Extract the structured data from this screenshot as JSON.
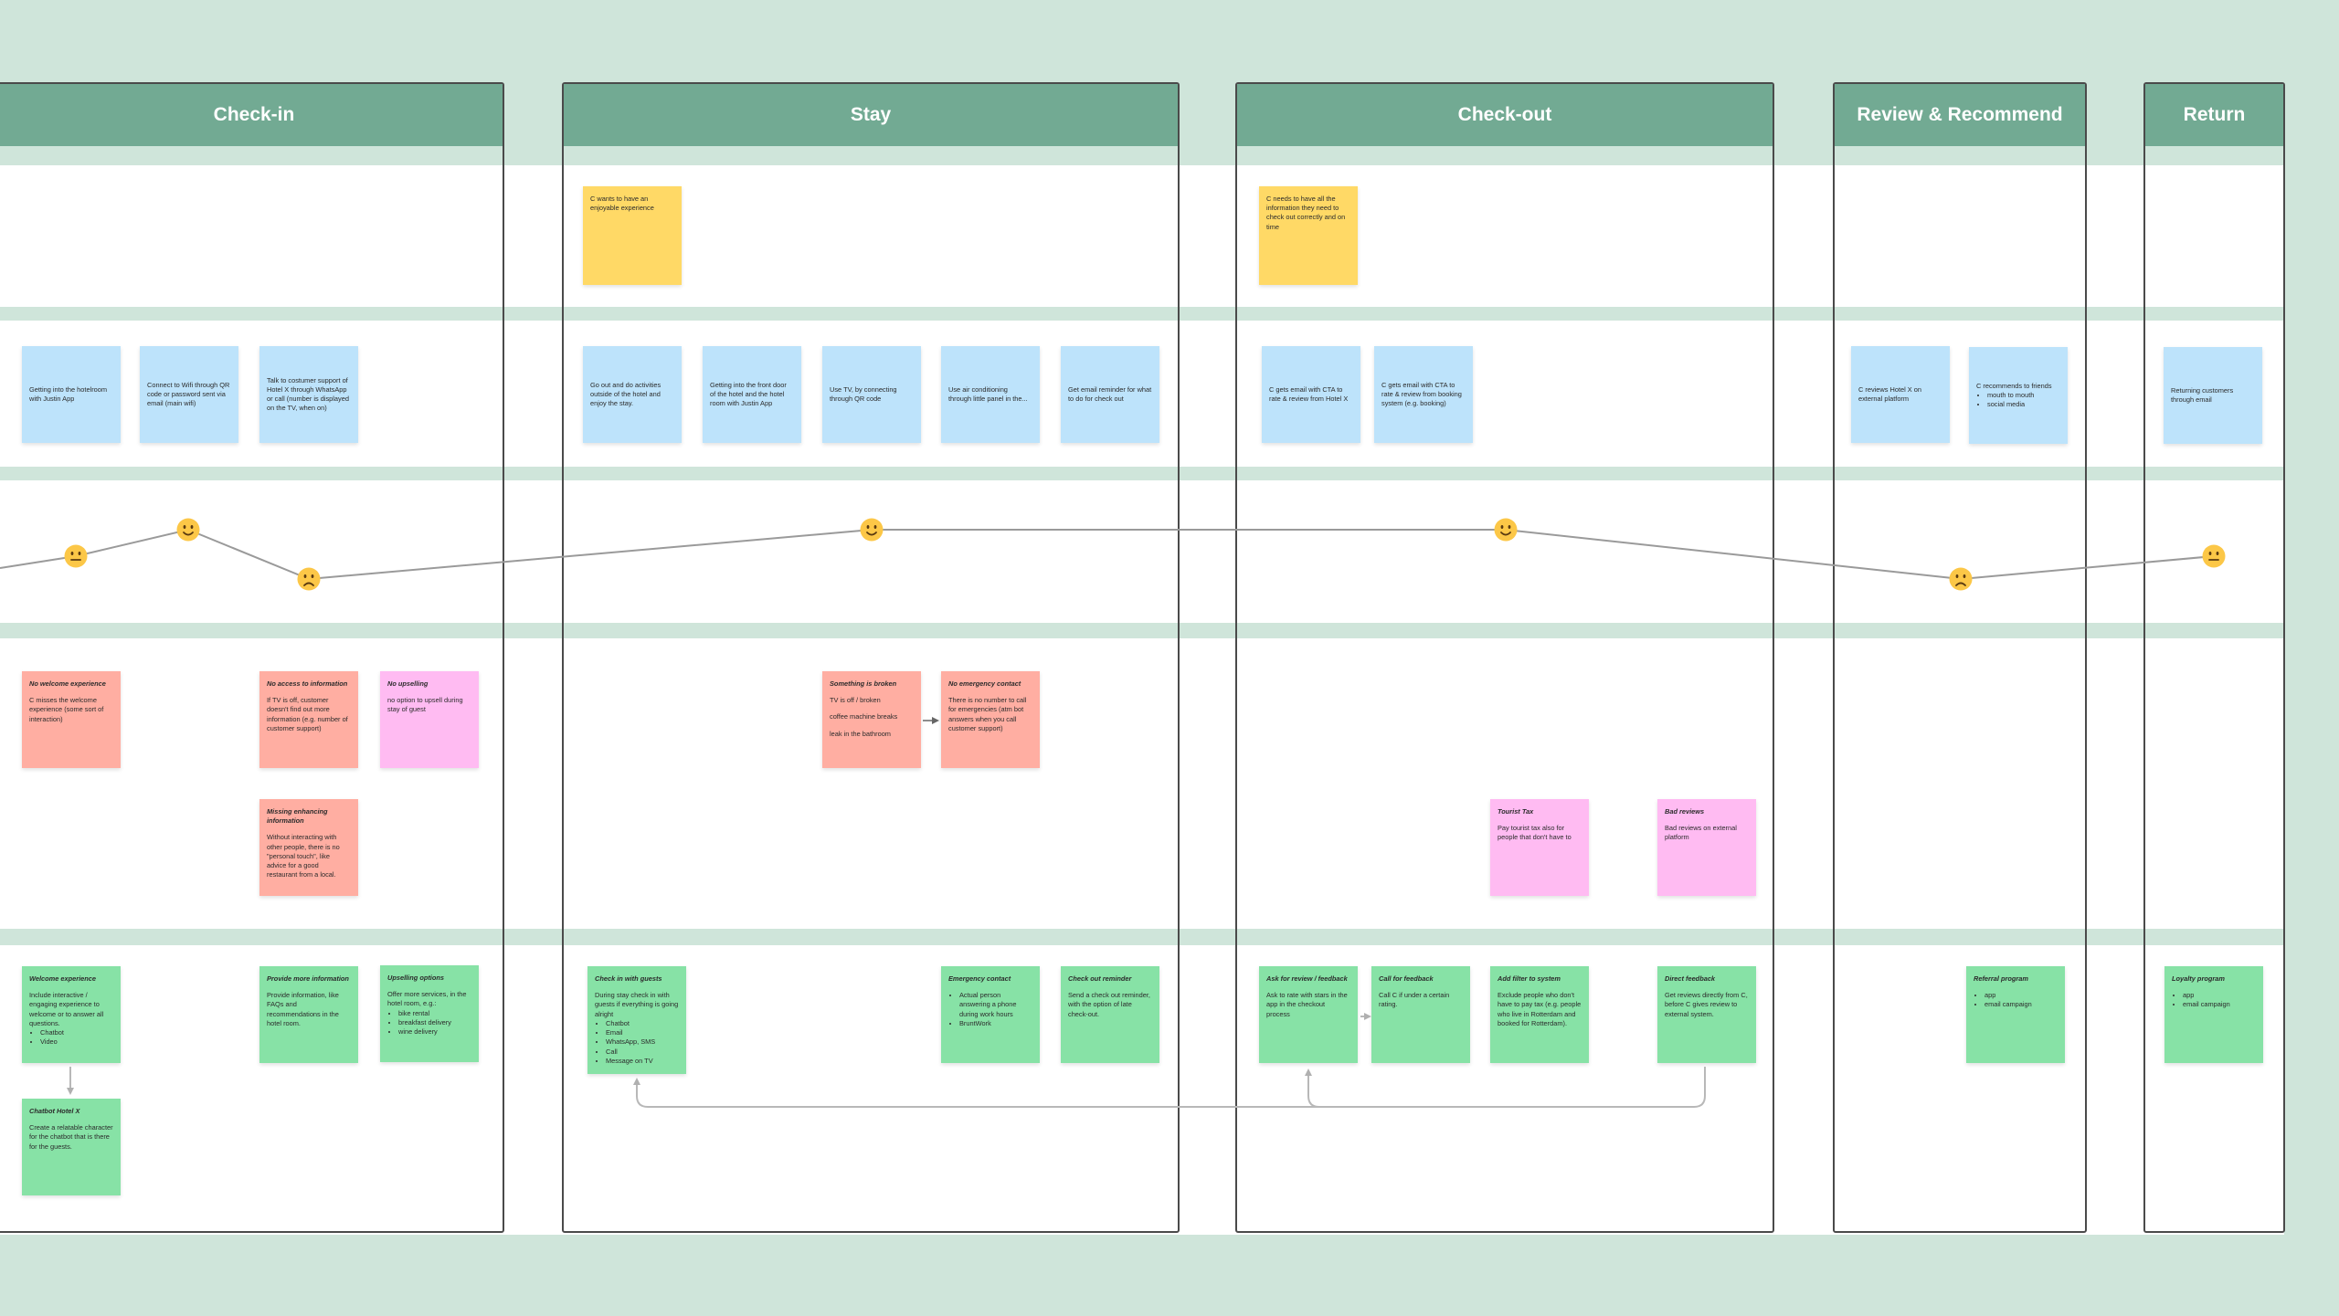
{
  "phases": [
    {
      "title": "Check-in"
    },
    {
      "title": "Stay"
    },
    {
      "title": "Check-out"
    },
    {
      "title": "Review & Recommend"
    },
    {
      "title": "Return"
    }
  ],
  "colors": {
    "header": "#72aa93",
    "band": "#cfe5da",
    "action": "#bde3fb",
    "goal": "#ffd966",
    "pain": "#ffaea2",
    "pain_alt": "#ffbbf2",
    "opportunity": "#87e2a6",
    "emotion": "#fcc747"
  },
  "goals": {
    "stay": {
      "body": [
        "C wants to have an enjoyable experience"
      ]
    },
    "checkout": {
      "body": [
        "C needs to have all the information they need to check out correctly and on time"
      ]
    }
  },
  "actions": {
    "checkin": [
      {
        "body": [
          "Getting into the hotelroom with Justin App"
        ]
      },
      {
        "body": [
          "Connect to Wifi through QR code or password sent via email (main wifi)"
        ]
      },
      {
        "body": [
          "Talk to costumer support of Hotel X through WhatsApp or call (number is displayed on the TV, when on)"
        ]
      }
    ],
    "stay": [
      {
        "body": [
          "Go out and do activities outside of the hotel and enjoy the stay."
        ]
      },
      {
        "body": [
          "Getting into the front door of the hotel and the hotel room with Justin App"
        ]
      },
      {
        "body": [
          "Use TV, by connecting through QR code"
        ]
      },
      {
        "body": [
          "Use air conditioning through little panel in the..."
        ]
      },
      {
        "body": [
          "Get email reminder for what to do for check out"
        ]
      }
    ],
    "checkout": [
      {
        "body": [
          "C gets email with CTA to rate  & review from Hotel X"
        ]
      },
      {
        "body": [
          "C gets email with CTA to rate & review from booking system (e.g. booking)"
        ]
      }
    ],
    "review": [
      {
        "body": [
          "C reviews Hotel X on external platform"
        ]
      },
      {
        "body": [
          "C recommends to friends"
        ],
        "bullets": [
          "mouth to mouth",
          "social media"
        ]
      }
    ],
    "return": [
      {
        "body": [
          "Returning customers through email"
        ]
      }
    ]
  },
  "emotions": [
    "neutral",
    "happy",
    "sad",
    "happy",
    "happy",
    "sad",
    "neutral"
  ],
  "pain_points": {
    "checkin": [
      {
        "title": "No welcome experience",
        "body": [
          "C misses the welcome experience (some sort of interaction)"
        ]
      },
      {
        "title": "No access to information",
        "body": [
          "If TV is off, customer doesn't find out more information (e.g. number of customer support)"
        ]
      },
      {
        "title": "No upselling",
        "body": [
          "no option to upsell during stay of guest"
        ]
      },
      {
        "title": "Missing enhancing information",
        "body": [
          "Without interacting with other people, there is no \"personal touch\", like advice for a good restaurant from a local."
        ]
      }
    ],
    "stay": [
      {
        "title": "Something is broken",
        "body": [
          "TV is off / broken",
          "coffee machine breaks",
          "leak in the bathroom"
        ]
      },
      {
        "title": "No emergency contact",
        "body": [
          "There is no number to call for emergencies (atm bot answers when you call customer support)"
        ]
      }
    ],
    "checkout": [
      {
        "title": "Tourist Tax",
        "body": [
          "Pay tourist tax also for people that don't have to"
        ]
      },
      {
        "title": "Bad reviews",
        "body": [
          "Bad reviews on external platform"
        ]
      }
    ]
  },
  "opportunities": {
    "checkin": [
      {
        "title": "Welcome experience",
        "body": [
          "Include interactive / engaging experience to welcome or to answer all questions."
        ],
        "bullets": [
          "Chatbot",
          "Video"
        ]
      },
      {
        "title": "Provide more information",
        "body": [
          "Provide information, like FAQs and recommendations in the hotel room."
        ]
      },
      {
        "title": "Upselling options",
        "body": [
          "Offer more services, in the hotel room, e.g.:"
        ],
        "bullets": [
          "bike rental",
          "breakfast delivery",
          "wine delivery"
        ]
      },
      {
        "title": "Chatbot Hotel X",
        "body": [
          "Create a relatable character for the chatbot that is there for the guests."
        ]
      }
    ],
    "stay": [
      {
        "title": "Check in with guests",
        "body": [
          "During stay check in with guests if everything is going alright"
        ],
        "bullets": [
          "Chatbot",
          "Email",
          "WhatsApp, SMS",
          "Call",
          "Message on TV"
        ]
      },
      {
        "title": "Emergency contact",
        "bullets": [
          "Actual person answering a phone during work hours",
          "BruntWork"
        ]
      },
      {
        "title": "Check out reminder",
        "body": [
          "Send a check out reminder, with the option of late check-out."
        ]
      }
    ],
    "checkout": [
      {
        "title": "Ask for review / feedback",
        "body": [
          "Ask to rate with stars in the app in the checkout process"
        ]
      },
      {
        "title": "Call for feedback",
        "body": [
          "Call C if under a certain rating."
        ]
      },
      {
        "title": "Add filter to system",
        "body": [
          "Exclude people who don't have to pay tax (e.g. people who live in Rotterdam and booked for Rotterdam)."
        ]
      },
      {
        "title": "Direct feedback",
        "body": [
          "Get reviews directly from C, before C gives review to external system."
        ]
      }
    ],
    "review": [
      {
        "title": "Referral program",
        "bullets": [
          "app",
          "email campaign"
        ]
      }
    ],
    "return": [
      {
        "title": "Loyalty program",
        "bullets": [
          "app",
          "email campaign"
        ]
      }
    ]
  }
}
